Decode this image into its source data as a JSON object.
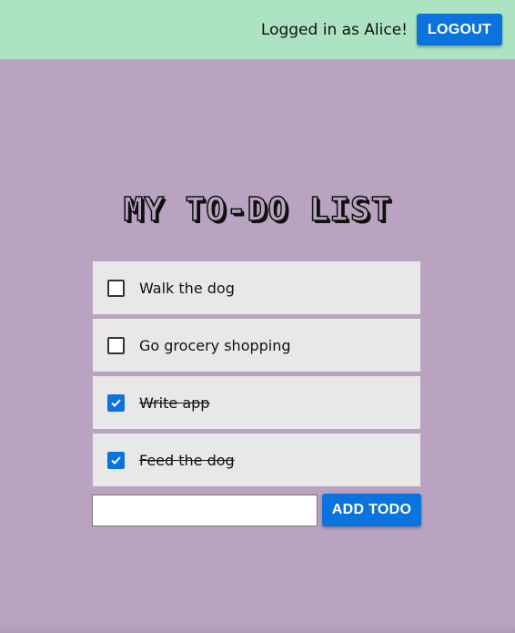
{
  "header": {
    "greeting": "Logged in as Alice!",
    "logout_label": "LOGOUT",
    "background": "#ace4c3"
  },
  "page": {
    "background": "#b9a3c0",
    "title": "MY TO-DO LIST"
  },
  "todos": [
    {
      "label": "Walk the dog",
      "done": false
    },
    {
      "label": "Go grocery shopping",
      "done": false
    },
    {
      "label": "Write app",
      "done": true
    },
    {
      "label": "Feed the dog",
      "done": true
    }
  ],
  "form": {
    "input_value": "",
    "input_placeholder": "",
    "add_label": "ADD TODO"
  },
  "colors": {
    "accent": "#0a73dd",
    "item_background": "#e8e8e8"
  }
}
